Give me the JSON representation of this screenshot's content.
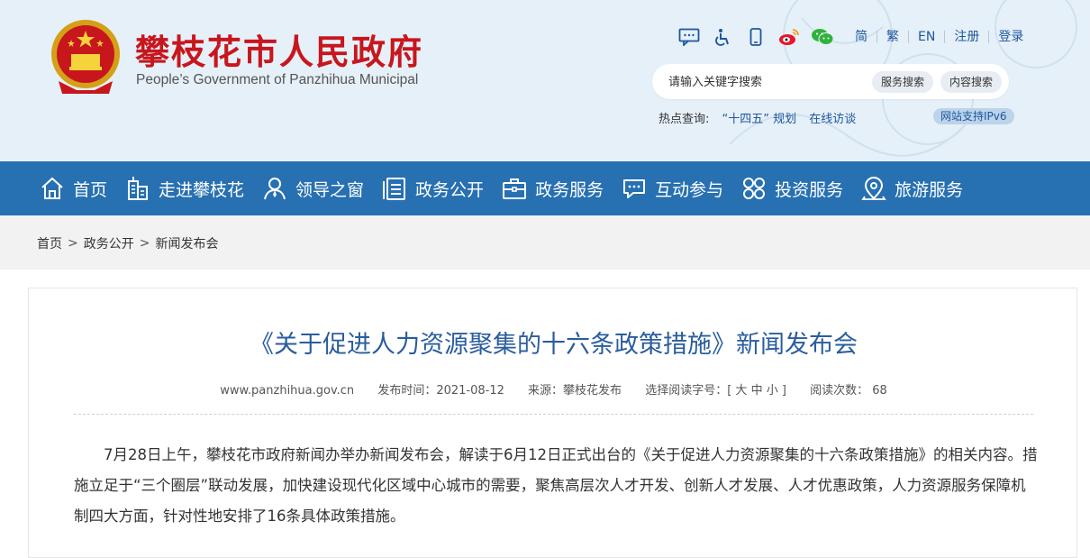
{
  "header": {
    "title": "攀枝花市人民政府",
    "subtitle": "People’s Government of Panzhihua Municipal",
    "emblem_icon": "national-emblem-icon",
    "tools": {
      "icons": [
        "message-icon",
        "accessibility-icon",
        "mobile-icon",
        "weibo-icon",
        "wechat-icon"
      ],
      "links": [
        "简",
        "繁",
        "EN",
        "注册",
        "登录"
      ]
    },
    "search": {
      "placeholder": "请输入关键字搜索",
      "service_search": "服务搜索",
      "content_search": "内容搜索"
    },
    "hot": {
      "label": "热点查询:",
      "items": [
        "“十四五” 规划",
        "在线访谈"
      ]
    },
    "ipv6": "网站支持IPv6"
  },
  "nav": {
    "items": [
      {
        "label": "首页",
        "icon": "home-icon"
      },
      {
        "label": "走进攀枝花",
        "icon": "building-icon"
      },
      {
        "label": "领导之窗",
        "icon": "person-icon"
      },
      {
        "label": "政务公开",
        "icon": "document-icon"
      },
      {
        "label": "政务服务",
        "icon": "briefcase-icon"
      },
      {
        "label": "互动参与",
        "icon": "chat-icon"
      },
      {
        "label": "投资服务",
        "icon": "grid-icon"
      },
      {
        "label": "旅游服务",
        "icon": "location-icon"
      }
    ]
  },
  "breadcrumb": [
    "首页",
    "政务公开",
    "新闻发布会"
  ],
  "article": {
    "title": "《关于促进人力资源聚集的十六条政策措施》新闻发布会",
    "meta": {
      "site": "www.panzhihua.gov.cn",
      "date": "发布时间：2021-08-12",
      "source": "来源：攀枝花发布",
      "font_label": "选择阅读字号：[",
      "font_sizes": [
        "大",
        "中",
        "小"
      ],
      "font_close": "]",
      "views": "阅读次数：  68"
    },
    "body": "7月28日上午，攀枝花市政府新闻办举办新闻发布会，解读于6月12日正式出台的《关于促进人力资源聚集的十六条政策措施》的相关内容。措施立足于“三个圈层”联动发展，加快建设现代化区域中心城市的需要，聚焦高层次人才开发、创新人才发展、人才优惠政策，人力资源服务保障机制四大方面，针对性地安排了16条具体政策措施。"
  },
  "colors": {
    "nav_bg": "#2770b1",
    "title_red": "#c8161d",
    "link_blue": "#1d57a0",
    "article_title": "#2a5d9e"
  }
}
